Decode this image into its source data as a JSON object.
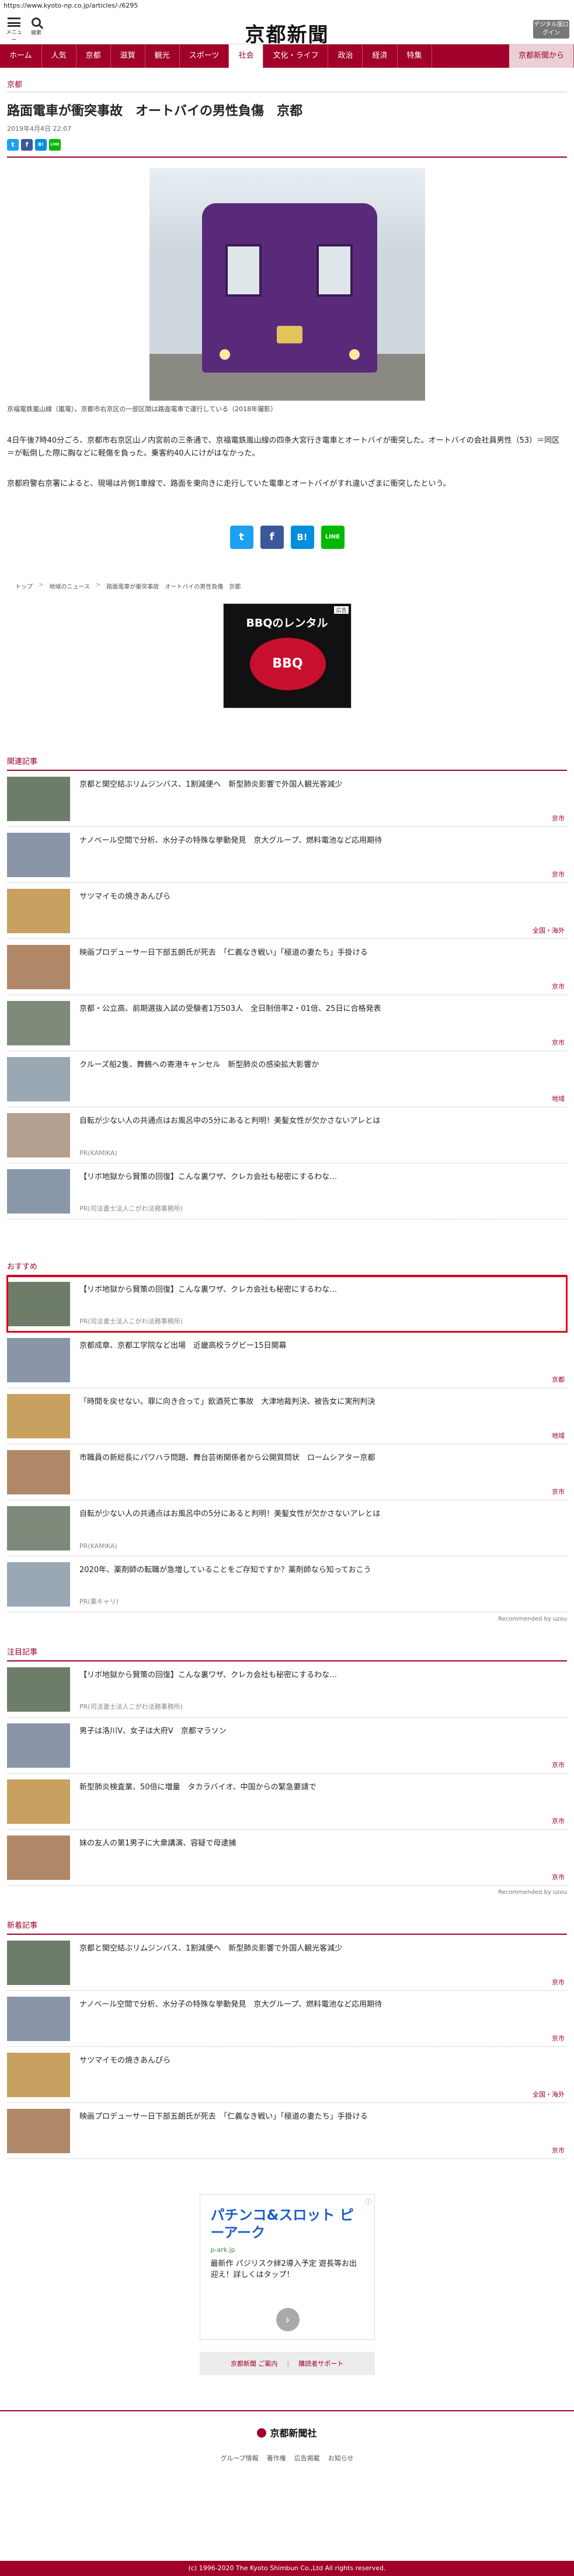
{
  "url": "https://www.kyoto-np.co.jp/articles/-/6295",
  "header": {
    "menu_label": "メニュー",
    "search_label": "検索",
    "logo": "京都新聞",
    "digital_button": "デジタル版ログイン"
  },
  "nav": {
    "items": [
      "ホーム",
      "人気",
      "京都",
      "滋賀",
      "観光",
      "スポーツ",
      "社会",
      "文化・ライフ",
      "政治",
      "経済",
      "特集"
    ],
    "active": "社会",
    "special": "京都新聞から"
  },
  "article": {
    "section": "京都",
    "title": "路面電車が衝突事故　オートバイの男性負傷　京都",
    "date": "2019年4月4日 22:07",
    "caption": "京福電鉄嵐山線（嵐電）。京都市右京区の一部区間は路面電車で運行している（2018年撮影）",
    "paragraphs": [
      "4日午後7時40分ごろ、京都市右京区山ノ内宮前の三条通で、京福電鉄嵐山線の四条大宮行き電車とオートバイが衝突した。オートバイの会社員男性（53）＝同区＝が転倒した際に胸などに軽傷を負った。乗客約40人にけがはなかった。",
      "京都府警右京署によると、現場は片側1車線で、路面を東向きに走行していた電車とオートバイがすれ違いざまに衝突したという。"
    ]
  },
  "share": {
    "twitter": "t",
    "facebook": "f",
    "hatena": "B!",
    "line": "LINE"
  },
  "breadcrumb": [
    "トップ",
    "地域のニュース",
    "路面電車が衝突事故　オートバイの男性負傷　京都"
  ],
  "ad_bbq": {
    "title": "BBQのレンタル",
    "logo": "BBQ",
    "tag": "広告"
  },
  "related": {
    "title": "関連記事",
    "items": [
      {
        "text": "京都と関空結ぶリムジンバス、1割減便へ　新型肺炎影響で外国人観光客減少",
        "meta": "京市"
      },
      {
        "text": "ナノベール空間で分析、水分子の特殊な挙動発見　京大グループ、燃料電池など応用期待",
        "meta": "京市"
      },
      {
        "text": "サツマイモの焼きあんぴら",
        "meta": "全国・海外"
      },
      {
        "text": "映画プロデューサー日下部五朗氏が死去　「仁義なき戦い」「極道の妻たち」手掛ける",
        "meta": "京市"
      },
      {
        "text": "京都・公立高、前期選抜入試の受験者1万503人　全日制倍率2・01倍、25日に合格発表",
        "meta": "京市"
      },
      {
        "text": "クルーズ船2隻、舞鶴への寄港キャンセル　新型肺炎の感染拡大影響か",
        "meta": "地域"
      },
      {
        "text": "自転が少ない人の共通点はお風呂中の5分にあると判明！美髪女性が欠かさないアレとは",
        "pr": "PR(KAMIKA)"
      },
      {
        "text": "【リボ地獄から賢策の回復】こんな裏ワザ、クレカ会社も秘密にするわな…",
        "pr": "PR(司法書士法人こがわ法務事務所)"
      }
    ]
  },
  "recommend": {
    "title": "おすすめ",
    "items": [
      {
        "text": "【リボ地獄から賢策の回復】こんな裏ワザ、クレカ会社も秘密にするわな…",
        "pr": "PR(司法書士法人こがわ法務事務所)"
      },
      {
        "text": "京都成章、京都工学院など出場　近畿高校ラグビー15日開幕",
        "meta": "京都"
      },
      {
        "text": "「時間を戻せない。罪に向き合って」飲酒死亡事故　大津地裁判決、被告女に実刑判決",
        "meta": "地域"
      },
      {
        "text": "市職員の新総長にパワハラ問題、舞台芸術関係者から公開質問状　ロームシアター京都",
        "meta": "京市"
      },
      {
        "text": "自転が少ない人の共通点はお風呂中の5分にあると判明！美髪女性が欠かさないアレとは",
        "pr": "PR(KAMIKA)"
      },
      {
        "text": "2020年、薬剤師の転職が急増していることをご存知ですか？薬剤師なら知っておこう",
        "pr": "PR(薬キャリ)"
      }
    ],
    "by": "Recommended by uzou"
  },
  "notable": {
    "title": "注目記事",
    "items": [
      {
        "text": "【リボ地獄から賢策の回復】こんな裏ワザ、クレカ会社も秘密にするわな…",
        "pr": "PR(司法書士法人こがわ法務事務所)"
      },
      {
        "text": "男子は洛川V、女子は大府V　京都マラソン",
        "meta": "京市"
      },
      {
        "text": "新型肺炎検査業、50倍に増量　タカラバイオ、中国からの緊急要請で",
        "meta": "京市"
      },
      {
        "text": "妹の友人の第1男子に大衆講演、容疑で母逮捕",
        "meta": "京市"
      }
    ],
    "by": "Recommended by uzou"
  },
  "latest": {
    "title": "新着記事",
    "items": [
      {
        "text": "京都と関空結ぶリムジンバス、1割減便へ　新型肺炎影響で外国人観光客減少",
        "meta": "京市"
      },
      {
        "text": "ナノベール空間で分析、水分子の特殊な挙動発見　京大グループ、燃料電池など応用期待",
        "meta": "京市"
      },
      {
        "text": "サツマイモの焼きあんぴら",
        "meta": "全国・海外"
      },
      {
        "text": "映画プロデューサー日下部五朗氏が死去　「仁義なき戦い」「極道の妻たち」手掛ける",
        "meta": "京市"
      }
    ]
  },
  "ad_pachinko": {
    "headline": "パチンコ&スロット ピーアーク",
    "domain": "p-ark.jp",
    "text": "最新作 パジリスク絆2導入予定 遊長等お出迎え！詳しくはタップ！"
  },
  "links_bar": [
    "京都新聞 ご案内",
    "購読者サポート"
  ],
  "footer": {
    "logo": "京都新聞社",
    "links": [
      "グループ情報",
      "著作権",
      "広告掲載",
      "お知らせ"
    ],
    "copyright": "(c) 1996-2020 The Kyoto Shimbun Co.,Ltd All rights reserved."
  },
  "colors": {
    "brand": "#a00029",
    "highlight": "#e0001b"
  }
}
